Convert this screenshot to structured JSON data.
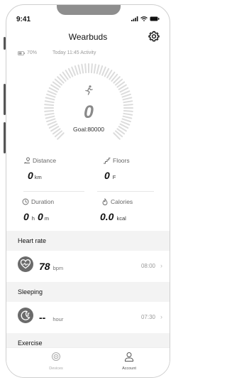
{
  "status": {
    "time": "9:41"
  },
  "header": {
    "title": "Wearbuds"
  },
  "info": {
    "battery": "70%",
    "activity_time": "Today 11:45  Activity"
  },
  "gauge": {
    "steps": "0",
    "goal_label": "Goal:80000",
    "progress": 0.0
  },
  "metrics": {
    "distance": {
      "label": "Distance",
      "value": "0",
      "unit": "km"
    },
    "floors": {
      "label": "Floors",
      "value": "0",
      "unit": "F"
    },
    "duration": {
      "label": "Duration",
      "value_h": "0",
      "unit_h": "h",
      "value_m": "0",
      "unit_m": "m"
    },
    "calories": {
      "label": "Calories",
      "value": "0.0",
      "unit": "kcal"
    }
  },
  "heart_rate": {
    "title": "Heart rate",
    "value": "78",
    "unit": "bpm",
    "time": "08:00"
  },
  "sleeping": {
    "title": "Sleeping",
    "value": "--",
    "unit": "hour",
    "time": "07:30"
  },
  "exercise": {
    "title": "Exercise"
  },
  "tabs": [
    {
      "label": "Devices",
      "icon": "devices-icon"
    },
    {
      "label": "Account",
      "icon": "account-icon"
    }
  ],
  "colors": {
    "icon_gray": "#6b6b6b",
    "gauge_tick": "#dcdcdc"
  }
}
